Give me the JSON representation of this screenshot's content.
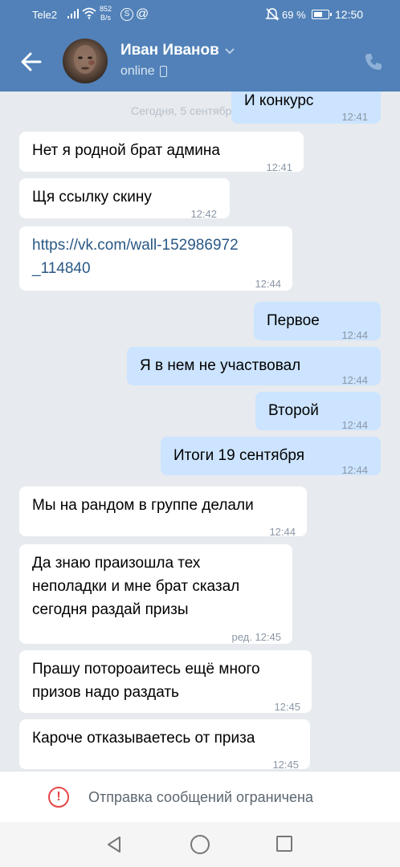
{
  "status_bar": {
    "carrier": "Tele2",
    "net_speed_value": "852",
    "net_speed_unit": "B/s",
    "battery_percent": "69 %",
    "battery_level": 0.69,
    "time": "12:50"
  },
  "header": {
    "name": "Иван Иванов",
    "status": "online"
  },
  "chat": {
    "date_separator": "Сегодня, 5 сентября",
    "messages": [
      {
        "dir": "out",
        "text": "И конкурс",
        "time": "12:41"
      },
      {
        "dir": "in",
        "text": "Нет я родной брат админа",
        "time": "12:41"
      },
      {
        "dir": "in",
        "text": "Щя ссылку скину",
        "time": "12:42"
      },
      {
        "dir": "in",
        "text": "https://vk.com/wall-152986972\n_114840",
        "time": "12:44",
        "is_link": true
      },
      {
        "dir": "out",
        "text": "Первое",
        "time": "12:44"
      },
      {
        "dir": "out",
        "text": "Я в нем не участвовал",
        "time": "12:44"
      },
      {
        "dir": "out",
        "text": "Второй",
        "time": "12:44"
      },
      {
        "dir": "out",
        "text": "Итоги 19 сентября",
        "time": "12:44"
      },
      {
        "dir": "in",
        "text": "Мы на рандом в группе делали",
        "time": "12:44"
      },
      {
        "dir": "in",
        "text": "Да знаю праизошла тех\nнеполадки и мне брат сказал\nсегодня раздай призы",
        "time": "ред. 12:45"
      },
      {
        "dir": "in",
        "text": "Прашу потороаитесь ещё много\nпризов надо раздать",
        "time": "12:45"
      },
      {
        "dir": "in",
        "text": "Кароче отказываетесь от приза",
        "time": "12:45"
      }
    ]
  },
  "composer": {
    "restricted_text": "Отправка сообщений ограничена",
    "warn_glyph": "!"
  },
  "colors": {
    "header_bg": "#5181b8",
    "chat_bg": "#e7eaee",
    "bubble_in": "#ffffff",
    "bubble_out": "#cce4ff",
    "link": "#2a5885",
    "warning": "#e64646"
  },
  "icons": {
    "back": "arrow-left-icon",
    "call": "phone-icon",
    "mobile": "mobile-phone-icon",
    "warning": "exclamation-circle-icon",
    "nav": [
      "nav-back-icon",
      "nav-home-icon",
      "nav-recents-icon"
    ]
  }
}
